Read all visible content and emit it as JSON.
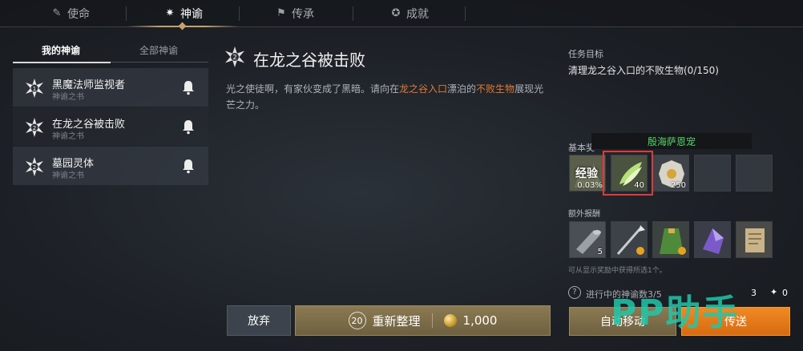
{
  "tabs": [
    {
      "label": "使命",
      "icon": "wrench-icon"
    },
    {
      "label": "神谕",
      "icon": "star-burst-icon"
    },
    {
      "label": "传承",
      "icon": "flag-icon"
    },
    {
      "label": "成就",
      "icon": "medal-icon"
    }
  ],
  "subtabs": {
    "mine": "我的神谕",
    "all": "全部神谕"
  },
  "quests": [
    {
      "title": "黑魔法师监视者",
      "sub": "神谕之书"
    },
    {
      "title": "在龙之谷被击败",
      "sub": "神谕之书"
    },
    {
      "title": "墓园灵体",
      "sub": "神谕之书"
    }
  ],
  "main": {
    "title": "在龙之谷被击败",
    "desc_a": "光之使徒啊，有家伙变成了黑暗。请向在",
    "desc_hl1": "龙之谷入口",
    "desc_b": "漂泊的",
    "desc_hl2": "不败生物",
    "desc_c": "展现光芒之力。"
  },
  "objective": {
    "label": "任务目标",
    "text": "清理龙之谷入口的不败生物(0/150)"
  },
  "basic_reward": {
    "label": "基本奖",
    "tooltip": "殷海萨恩宠",
    "items": [
      {
        "icon": "exp-icon",
        "text": "经验",
        "count": "0.03%"
      },
      {
        "icon": "feather-leaf-icon",
        "count": "40"
      },
      {
        "icon": "gold-coin-icon",
        "count": "250"
      },
      {
        "icon": "empty-slot-icon",
        "count": ""
      },
      {
        "icon": "empty-slot-icon",
        "count": ""
      }
    ]
  },
  "extra_reward": {
    "label": "额外报酬",
    "items": [
      {
        "icon": "scroll-roll-icon",
        "count": "5"
      },
      {
        "icon": "spear-icon",
        "count": ""
      },
      {
        "icon": "green-cloak-icon",
        "count": ""
      },
      {
        "icon": "purple-crystal-icon",
        "count": ""
      },
      {
        "icon": "parchment-icon",
        "count": ""
      }
    ],
    "note": "可从显示奖励中获得所选1个。"
  },
  "progress": {
    "text": "进行中的神谕数3/5",
    "count_a": "3",
    "count_b": "0"
  },
  "buttons": {
    "abandon": "放弃",
    "reorganize": "重新整理",
    "reorganize_badge": "20",
    "cost": "1,000",
    "auto_move": "自动移动",
    "teleport": "传送"
  },
  "watermark": "PP助手",
  "colors": {
    "accent_orange": "#e07a32",
    "tooltip_green": "#59d36a",
    "highlight_red": "#e03a3a",
    "gold": "#c6a26a"
  }
}
